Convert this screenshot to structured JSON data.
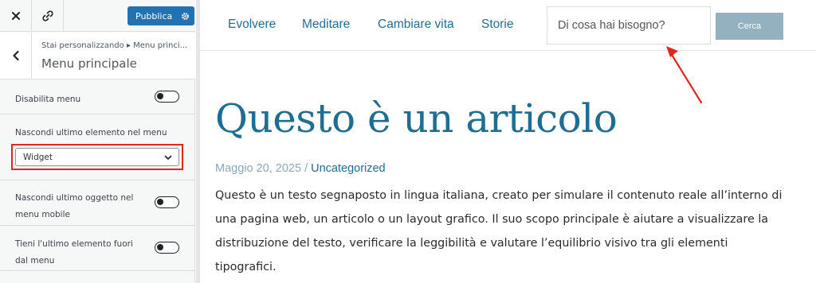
{
  "customizer": {
    "publish_label": "Pubblica",
    "breadcrumb_prefix": "Stai personalizzando",
    "breadcrumb_separator": "▸",
    "breadcrumb_section": "Menu princi...",
    "section_title": "Menu principale",
    "controls": {
      "disable_menu_label": "Disabilita menu",
      "hide_last_label": "Nascondi ultimo elemento nel menu",
      "hide_last_value": "Widget",
      "hide_last_mobile_label": "Nascondi ultimo oggetto nel menu mobile",
      "keep_last_outside_label": "Tieni l'ultimo elemento fuori dal menu"
    },
    "toggles": {
      "disable_menu": false,
      "hide_last_mobile": false,
      "keep_last_outside": false
    }
  },
  "site": {
    "nav": [
      "Evolvere",
      "Meditare",
      "Cambiare vita",
      "Storie"
    ],
    "search": {
      "placeholder": "Di cosa hai bisogno?",
      "button_label": "Cerca"
    }
  },
  "post": {
    "title": "Questo è un articolo",
    "date": "Maggio 20, 2025",
    "separator": "/",
    "category": "Uncategorized",
    "body": "Questo è un testo segnaposto in lingua italiana, creato per simulare il contenuto reale all’interno di una pagina web, un articolo o un layout grafico. Il suo scopo principale è aiutare a visualizzare la distribuzione del testo, verificare la leggibilità e valutare l’equilibrio visivo tra gli elementi tipografici."
  },
  "colors": {
    "accent": "#1e6e93",
    "publish": "#2271b1",
    "highlight_box": "#e0271f",
    "annotation_arrow": "#e0271f",
    "search_button": "#93b1be"
  },
  "icons": [
    "close-icon",
    "link-icon",
    "gear-icon",
    "back-chevron-icon",
    "chevron-down-icon",
    "annotation-arrow"
  ]
}
